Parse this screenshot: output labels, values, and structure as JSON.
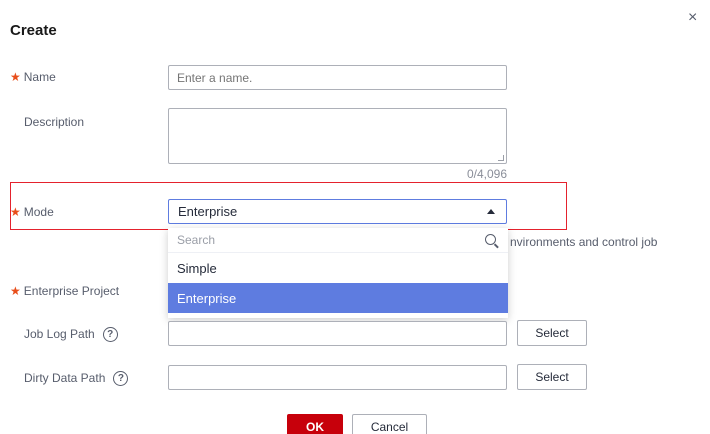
{
  "dialog": {
    "title": "Create",
    "close_icon": "×"
  },
  "form": {
    "name": {
      "label": "Name",
      "placeholder": "Enter a name."
    },
    "description": {
      "label": "Description",
      "counter": "0/4,096"
    },
    "mode": {
      "label": "Mode",
      "value": "Enterprise",
      "search_placeholder": "Search",
      "options": [
        "Simple",
        "Enterprise"
      ],
      "selected": "Enterprise",
      "hint_partial": "nvironments and control job"
    },
    "enterprise_project": {
      "label": "Enterprise Project"
    },
    "job_log_path": {
      "label": "Job Log Path",
      "button": "Select"
    },
    "dirty_data_path": {
      "label": "Dirty Data Path",
      "button": "Select"
    }
  },
  "footer": {
    "ok": "OK",
    "cancel": "Cancel"
  },
  "colors": {
    "required": "#e84e1b",
    "highlight": "#e4222d",
    "selected_option": "#5e7ce0",
    "primary_button": "#c7000b"
  },
  "icons": {
    "search": "search-icon",
    "help": "help-icon",
    "close": "close-icon",
    "caret": "caret-up-icon"
  }
}
